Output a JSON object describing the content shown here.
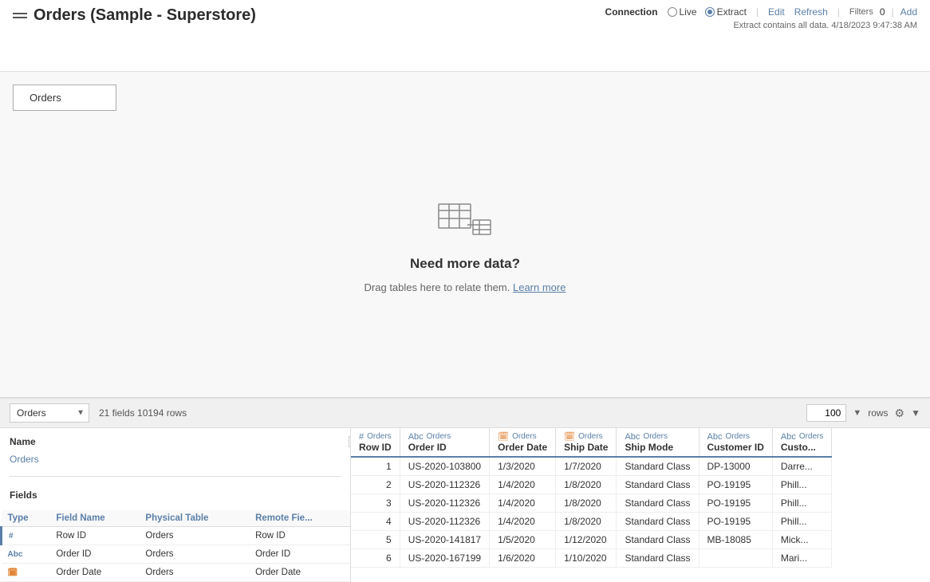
{
  "header": {
    "title": "Orders (Sample - Superstore)",
    "menu_icon": "menu-icon",
    "connection": {
      "label": "Connection",
      "live_label": "Live",
      "extract_label": "Extract",
      "extract_selected": true,
      "edit_label": "Edit",
      "refresh_label": "Refresh",
      "extract_info": "Extract contains all data. 4/18/2023 9:47:38 AM"
    },
    "filters": {
      "label": "Filters",
      "count": "0",
      "add_label": "Add"
    }
  },
  "canvas": {
    "orders_box_label": "Orders",
    "need_more_data": "Need more data?",
    "drag_hint": "Drag tables here to relate them.",
    "learn_more": "Learn more"
  },
  "bottom": {
    "table_select": "Orders",
    "fields_info": "21 fields 10194 rows",
    "rows_value": "100",
    "rows_label": "rows"
  },
  "sidebar": {
    "name_label": "Name",
    "orders_item": "Orders",
    "fields_label": "Fields",
    "columns": {
      "type": "Type",
      "field_name": "Field Name",
      "physical_table": "Physical Table",
      "remote_field": "Remote Fie..."
    },
    "rows": [
      {
        "type": "hash",
        "field_name": "Row ID",
        "table": "Orders",
        "remote": "Row ID"
      },
      {
        "type": "abc",
        "field_name": "Order ID",
        "table": "Orders",
        "remote": "Order ID"
      },
      {
        "type": "cal",
        "field_name": "Order Date",
        "table": "Orders",
        "remote": "Order Date"
      }
    ]
  },
  "data_grid": {
    "columns": [
      {
        "type": "hash",
        "source": "Orders",
        "name": "Row ID"
      },
      {
        "type": "abc",
        "source": "Orders",
        "name": "Order ID"
      },
      {
        "type": "cal",
        "source": "Orders",
        "name": "Order Date"
      },
      {
        "type": "cal",
        "source": "Orders",
        "name": "Ship Date"
      },
      {
        "type": "abc",
        "source": "Orders",
        "name": "Ship Mode"
      },
      {
        "type": "abc",
        "source": "Orders",
        "name": "Customer ID"
      },
      {
        "type": "abc",
        "source": "Orders",
        "name": "Custo..."
      }
    ],
    "rows": [
      {
        "row_id": "1",
        "order_id": "US-2020-103800",
        "order_date": "1/3/2020",
        "ship_date": "1/7/2020",
        "ship_mode": "Standard Class",
        "customer_id": "DP-13000",
        "customer": "Darre..."
      },
      {
        "row_id": "2",
        "order_id": "US-2020-112326",
        "order_date": "1/4/2020",
        "ship_date": "1/8/2020",
        "ship_mode": "Standard Class",
        "customer_id": "PO-19195",
        "customer": "Phill..."
      },
      {
        "row_id": "3",
        "order_id": "US-2020-112326",
        "order_date": "1/4/2020",
        "ship_date": "1/8/2020",
        "ship_mode": "Standard Class",
        "customer_id": "PO-19195",
        "customer": "Phill..."
      },
      {
        "row_id": "4",
        "order_id": "US-2020-112326",
        "order_date": "1/4/2020",
        "ship_date": "1/8/2020",
        "ship_mode": "Standard Class",
        "customer_id": "PO-19195",
        "customer": "Phill..."
      },
      {
        "row_id": "5",
        "order_id": "US-2020-141817",
        "order_date": "1/5/2020",
        "ship_date": "1/12/2020",
        "ship_mode": "Standard Class",
        "customer_id": "MB-18085",
        "customer": "Mick..."
      },
      {
        "row_id": "6",
        "order_id": "US-2020-167199",
        "order_date": "1/6/2020",
        "ship_date": "1/10/2020",
        "ship_mode": "Standard Class",
        "customer_id": "",
        "customer": "Mari..."
      }
    ]
  }
}
